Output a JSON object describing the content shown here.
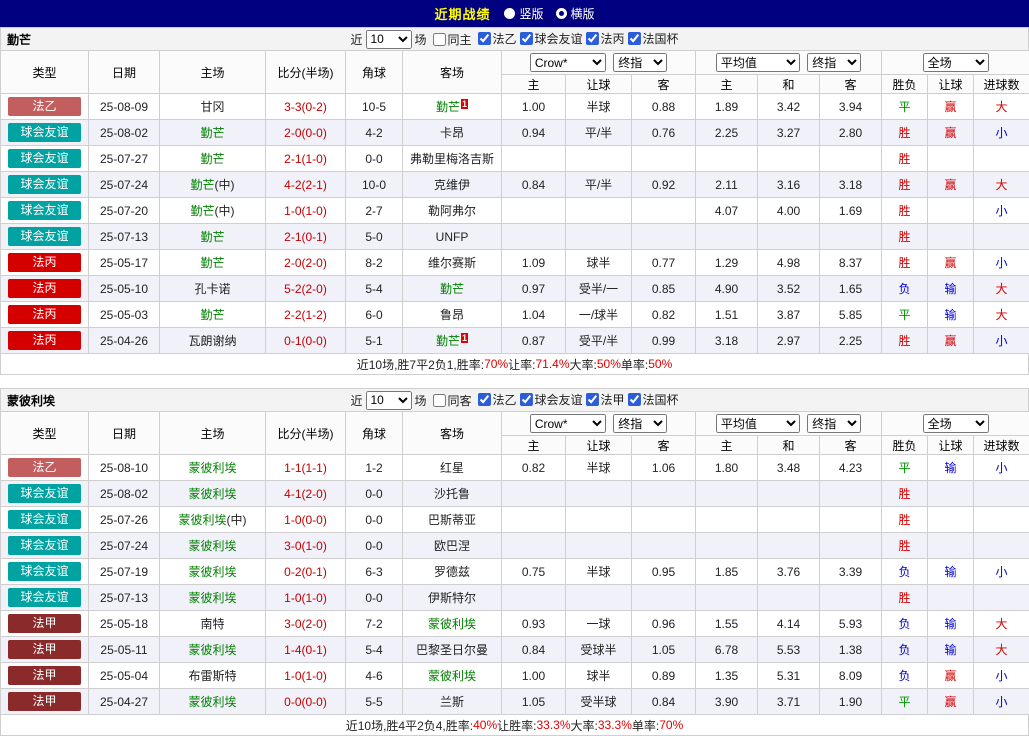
{
  "topbar": {
    "title": "近期战绩",
    "radios": [
      {
        "label": "竖版",
        "selected": false
      },
      {
        "label": "横版",
        "selected": true
      }
    ]
  },
  "colors": {
    "topbar_bg": "#000080",
    "title_text": "#FFFF00",
    "leagues": {
      "法乙": "#C25E5E",
      "球会友谊": "#00A2A2",
      "法丙": "#D40000",
      "法甲": "#8B2A2A"
    },
    "win_text": "#D60000",
    "lose_text": "#0000D6",
    "draw_text": "#009900",
    "self_team_text": "#008000",
    "score_text": "#C00000",
    "alt_row_bg": "#F1F1FA"
  },
  "table": {
    "cols": [
      "类型",
      "日期",
      "主场",
      "比分(半场)",
      "角球",
      "客场"
    ],
    "asia_cols": [
      "主",
      "让球",
      "客"
    ],
    "euro_cols": [
      "主",
      "和",
      "客"
    ],
    "result_cols": [
      "胜负",
      "让球",
      "进球数"
    ],
    "dropdowns": {
      "bookmaker": "Crow*",
      "final_asia": "终指",
      "average": "平均值",
      "final_euro": "终指",
      "scope": "全场"
    }
  },
  "sections": [
    {
      "team": "勤芒",
      "filter": {
        "near_label": "近",
        "count": "10",
        "matches_label": "场",
        "same": {
          "label": "同主",
          "checked": false
        },
        "leagues": [
          {
            "label": "法乙",
            "checked": true
          },
          {
            "label": "球会友谊",
            "checked": true
          },
          {
            "label": "法丙",
            "checked": true
          },
          {
            "label": "法国杯",
            "checked": true
          }
        ]
      },
      "rows": [
        {
          "type": "法乙",
          "date": "25-08-09",
          "home": {
            "name": "甘冈"
          },
          "score": "3-3(0-2)",
          "corner": "10-5",
          "away": {
            "name": "勤芒",
            "self": true,
            "badge": "1"
          },
          "odds": [
            "1.00",
            "半球",
            "0.88",
            "1.89",
            "3.42",
            "3.94"
          ],
          "result": [
            "平",
            "赢",
            "大"
          ]
        },
        {
          "type": "球会友谊",
          "date": "25-08-02",
          "home": {
            "name": "勤芒",
            "self": true
          },
          "score": "2-0(0-0)",
          "corner": "4-2",
          "away": {
            "name": "卡昂"
          },
          "odds": [
            "0.94",
            "平/半",
            "0.76",
            "2.25",
            "3.27",
            "2.80"
          ],
          "result": [
            "胜",
            "赢",
            "小"
          ]
        },
        {
          "type": "球会友谊",
          "date": "25-07-27",
          "home": {
            "name": "勤芒",
            "self": true
          },
          "score": "2-1(1-0)",
          "corner": "0-0",
          "away": {
            "name": "弗勒里梅洛吉斯"
          },
          "odds": [
            "",
            "",
            "",
            "",
            "",
            ""
          ],
          "result": [
            "胜",
            "",
            ""
          ]
        },
        {
          "type": "球会友谊",
          "date": "25-07-24",
          "home": {
            "name": "勤芒",
            "self": true,
            "suffix": "(中)"
          },
          "score": "4-2(2-1)",
          "corner": "10-0",
          "away": {
            "name": "克维伊"
          },
          "odds": [
            "0.84",
            "平/半",
            "0.92",
            "2.11",
            "3.16",
            "3.18"
          ],
          "result": [
            "胜",
            "赢",
            "大"
          ]
        },
        {
          "type": "球会友谊",
          "date": "25-07-20",
          "home": {
            "name": "勤芒",
            "self": true,
            "suffix": "(中)"
          },
          "score": "1-0(1-0)",
          "corner": "2-7",
          "away": {
            "name": "勒阿弗尔"
          },
          "odds": [
            "",
            "",
            "",
            "4.07",
            "4.00",
            "1.69"
          ],
          "result": [
            "胜",
            "",
            "小"
          ]
        },
        {
          "type": "球会友谊",
          "date": "25-07-13",
          "home": {
            "name": "勤芒",
            "self": true
          },
          "score": "2-1(0-1)",
          "corner": "5-0",
          "away": {
            "name": "UNFP"
          },
          "odds": [
            "",
            "",
            "",
            "",
            "",
            ""
          ],
          "result": [
            "胜",
            "",
            ""
          ]
        },
        {
          "type": "法丙",
          "date": "25-05-17",
          "home": {
            "name": "勤芒",
            "self": true
          },
          "score": "2-0(2-0)",
          "corner": "8-2",
          "away": {
            "name": "维尔赛斯"
          },
          "odds": [
            "1.09",
            "球半",
            "0.77",
            "1.29",
            "4.98",
            "8.37"
          ],
          "result": [
            "胜",
            "赢",
            "小"
          ]
        },
        {
          "type": "法丙",
          "date": "25-05-10",
          "home": {
            "name": "孔卡诺"
          },
          "score": "5-2(2-0)",
          "corner": "5-4",
          "away": {
            "name": "勤芒",
            "self": true
          },
          "odds": [
            "0.97",
            "受半/一",
            "0.85",
            "4.90",
            "3.52",
            "1.65"
          ],
          "result": [
            "负",
            "输",
            "大"
          ]
        },
        {
          "type": "法丙",
          "date": "25-05-03",
          "home": {
            "name": "勤芒",
            "self": true
          },
          "score": "2-2(1-2)",
          "corner": "6-0",
          "away": {
            "name": "鲁昂"
          },
          "odds": [
            "1.04",
            "一/球半",
            "0.82",
            "1.51",
            "3.87",
            "5.85"
          ],
          "result": [
            "平",
            "输",
            "大"
          ]
        },
        {
          "type": "法丙",
          "date": "25-04-26",
          "home": {
            "name": "瓦朗谢纳"
          },
          "score": "0-1(0-0)",
          "corner": "5-1",
          "away": {
            "name": "勤芒",
            "self": true,
            "badge": "1"
          },
          "odds": [
            "0.87",
            "受平/半",
            "0.99",
            "3.18",
            "2.97",
            "2.25"
          ],
          "result": [
            "胜",
            "赢",
            "小"
          ]
        }
      ],
      "summary": [
        {
          "text": "近10场,胜7平2负1, ",
          "red": false
        },
        {
          "text": "胜率:",
          "red": false
        },
        {
          "text": "70%",
          "red": true
        },
        {
          "text": " 让率:",
          "red": false
        },
        {
          "text": "71.4%",
          "red": true
        },
        {
          "text": " 大率:",
          "red": false
        },
        {
          "text": "50%",
          "red": true
        },
        {
          "text": " 单率:",
          "red": false
        },
        {
          "text": "50%",
          "red": true
        }
      ]
    },
    {
      "team": "蒙彼利埃",
      "filter": {
        "near_label": "近",
        "count": "10",
        "matches_label": "场",
        "same": {
          "label": "同客",
          "checked": false
        },
        "leagues": [
          {
            "label": "法乙",
            "checked": true
          },
          {
            "label": "球会友谊",
            "checked": true
          },
          {
            "label": "法甲",
            "checked": true
          },
          {
            "label": "法国杯",
            "checked": true
          }
        ]
      },
      "rows": [
        {
          "type": "法乙",
          "date": "25-08-10",
          "home": {
            "name": "蒙彼利埃",
            "self": true
          },
          "score": "1-1(1-1)",
          "corner": "1-2",
          "away": {
            "name": "红星"
          },
          "odds": [
            "0.82",
            "半球",
            "1.06",
            "1.80",
            "3.48",
            "4.23"
          ],
          "result": [
            "平",
            "输",
            "小"
          ]
        },
        {
          "type": "球会友谊",
          "date": "25-08-02",
          "home": {
            "name": "蒙彼利埃",
            "self": true
          },
          "score": "4-1(2-0)",
          "corner": "0-0",
          "away": {
            "name": "沙托鲁"
          },
          "odds": [
            "",
            "",
            "",
            "",
            "",
            ""
          ],
          "result": [
            "胜",
            "",
            ""
          ]
        },
        {
          "type": "球会友谊",
          "date": "25-07-26",
          "home": {
            "name": "蒙彼利埃",
            "self": true,
            "suffix": "(中)"
          },
          "score": "1-0(0-0)",
          "corner": "0-0",
          "away": {
            "name": "巴斯蒂亚"
          },
          "odds": [
            "",
            "",
            "",
            "",
            "",
            ""
          ],
          "result": [
            "胜",
            "",
            ""
          ]
        },
        {
          "type": "球会友谊",
          "date": "25-07-24",
          "home": {
            "name": "蒙彼利埃",
            "self": true
          },
          "score": "3-0(1-0)",
          "corner": "0-0",
          "away": {
            "name": "欧巴涅"
          },
          "odds": [
            "",
            "",
            "",
            "",
            "",
            ""
          ],
          "result": [
            "胜",
            "",
            ""
          ]
        },
        {
          "type": "球会友谊",
          "date": "25-07-19",
          "home": {
            "name": "蒙彼利埃",
            "self": true
          },
          "score": "0-2(0-1)",
          "corner": "6-3",
          "away": {
            "name": "罗德兹"
          },
          "odds": [
            "0.75",
            "半球",
            "0.95",
            "1.85",
            "3.76",
            "3.39"
          ],
          "result": [
            "负",
            "输",
            "小"
          ]
        },
        {
          "type": "球会友谊",
          "date": "25-07-13",
          "home": {
            "name": "蒙彼利埃",
            "self": true
          },
          "score": "1-0(1-0)",
          "corner": "0-0",
          "away": {
            "name": "伊斯特尔"
          },
          "odds": [
            "",
            "",
            "",
            "",
            "",
            ""
          ],
          "result": [
            "胜",
            "",
            ""
          ]
        },
        {
          "type": "法甲",
          "date": "25-05-18",
          "home": {
            "name": "南特"
          },
          "score": "3-0(2-0)",
          "corner": "7-2",
          "away": {
            "name": "蒙彼利埃",
            "self": true
          },
          "odds": [
            "0.93",
            "一球",
            "0.96",
            "1.55",
            "4.14",
            "5.93"
          ],
          "result": [
            "负",
            "输",
            "大"
          ]
        },
        {
          "type": "法甲",
          "date": "25-05-11",
          "home": {
            "name": "蒙彼利埃",
            "self": true
          },
          "score": "1-4(0-1)",
          "corner": "5-4",
          "away": {
            "name": "巴黎圣日尔曼"
          },
          "odds": [
            "0.84",
            "受球半",
            "1.05",
            "6.78",
            "5.53",
            "1.38"
          ],
          "result": [
            "负",
            "输",
            "大"
          ]
        },
        {
          "type": "法甲",
          "date": "25-05-04",
          "home": {
            "name": "布雷斯特"
          },
          "score": "1-0(1-0)",
          "corner": "4-6",
          "away": {
            "name": "蒙彼利埃",
            "self": true
          },
          "odds": [
            "1.00",
            "球半",
            "0.89",
            "1.35",
            "5.31",
            "8.09"
          ],
          "result": [
            "负",
            "赢",
            "小"
          ]
        },
        {
          "type": "法甲",
          "date": "25-04-27",
          "home": {
            "name": "蒙彼利埃",
            "self": true
          },
          "score": "0-0(0-0)",
          "corner": "5-5",
          "away": {
            "name": "兰斯"
          },
          "odds": [
            "1.05",
            "受半球",
            "0.84",
            "3.90",
            "3.71",
            "1.90"
          ],
          "result": [
            "平",
            "赢",
            "小"
          ]
        }
      ],
      "summary": [
        {
          "text": "近10场,胜4平2负4, ",
          "red": false
        },
        {
          "text": "胜率:",
          "red": false
        },
        {
          "text": "40%",
          "red": true
        },
        {
          "text": " 让胜率:",
          "red": false
        },
        {
          "text": "33.3%",
          "red": true
        },
        {
          "text": " 大率:",
          "red": false
        },
        {
          "text": "33.3%",
          "red": true
        },
        {
          "text": " 单率:",
          "red": false
        },
        {
          "text": "70%",
          "red": true
        }
      ]
    }
  ]
}
